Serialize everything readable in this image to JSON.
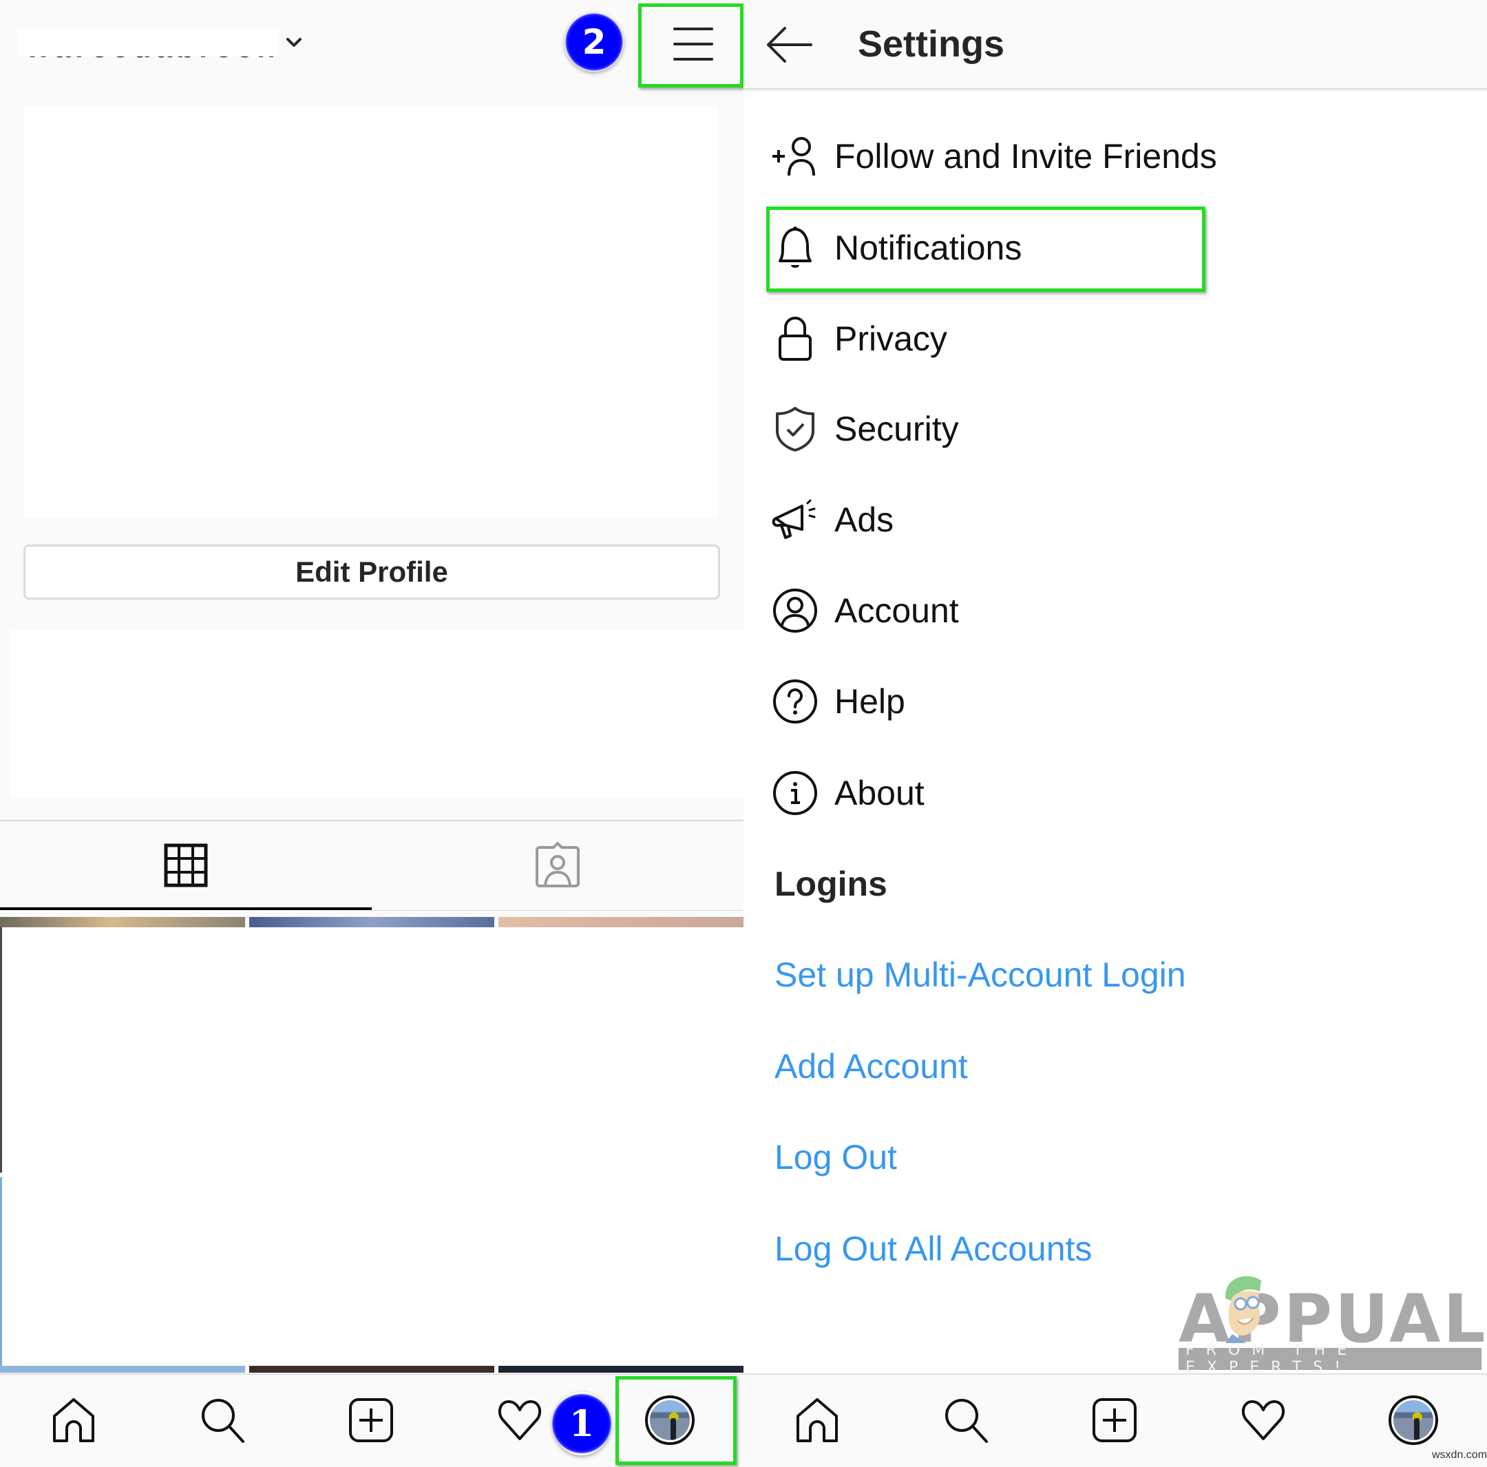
{
  "profile_screen": {
    "username": "",
    "username_redacted": true,
    "edit_profile_label": "Edit Profile",
    "tabs": [
      {
        "name": "grid",
        "icon": "grid-icon",
        "active": true
      },
      {
        "name": "tagged",
        "icon": "tagged-photos-icon",
        "active": false
      }
    ],
    "annotation_badge": "2",
    "menu_icon": "hamburger-menu-icon"
  },
  "settings_screen": {
    "title": "Settings",
    "back_icon": "back-arrow-icon",
    "menu_items": [
      {
        "label": "Follow and Invite Friends",
        "icon": "add-person-icon"
      },
      {
        "label": "Notifications",
        "icon": "bell-icon",
        "highlighted": true
      },
      {
        "label": "Privacy",
        "icon": "lock-icon"
      },
      {
        "label": "Security",
        "icon": "shield-check-icon"
      },
      {
        "label": "Ads",
        "icon": "megaphone-icon"
      },
      {
        "label": "Account",
        "icon": "account-circle-icon"
      },
      {
        "label": "Help",
        "icon": "help-circle-icon"
      },
      {
        "label": "About",
        "icon": "info-circle-icon"
      }
    ],
    "logins_section": {
      "heading": "Logins",
      "links": [
        "Set up Multi-Account Login",
        "Add Account",
        "Log Out",
        "Log Out All Accounts"
      ]
    },
    "link_color": "#3897f0"
  },
  "bottom_nav": {
    "items": [
      {
        "name": "home",
        "icon": "home-icon"
      },
      {
        "name": "search",
        "icon": "search-icon"
      },
      {
        "name": "new-post",
        "icon": "add-post-icon"
      },
      {
        "name": "activity",
        "icon": "heart-icon"
      },
      {
        "name": "profile",
        "icon": "avatar"
      }
    ],
    "annotation_badge": "1"
  },
  "watermark": {
    "logo_text": "APPUALS",
    "logo_tagline": "FROM THE EXPERTS!",
    "site": "wsxdn.com"
  },
  "highlight_color": "#22dd22",
  "badge_color": "#0000ff"
}
